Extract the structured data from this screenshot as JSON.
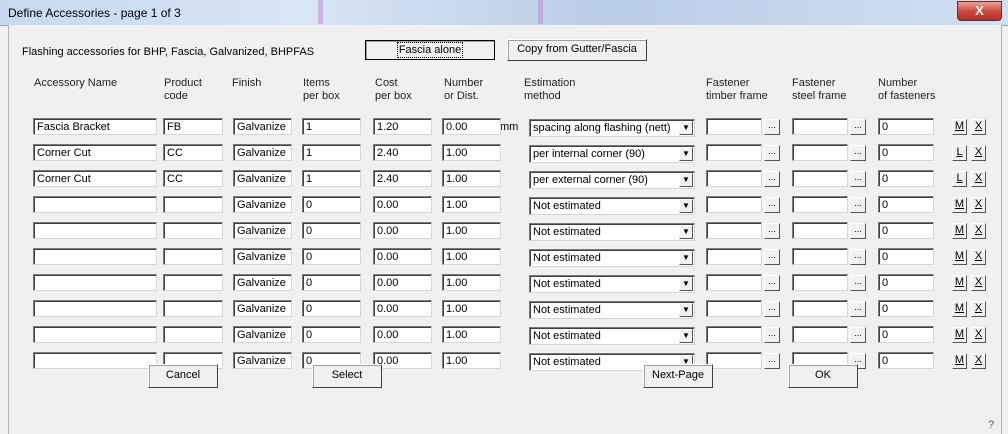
{
  "window": {
    "title": "Define Accessories - page 1 of 3",
    "close_label": "X"
  },
  "top": {
    "subtitle": "Flashing accessories for BHP, Fascia, Galvanized, BHPFAS",
    "fascia_alone": "Fascia alone",
    "copy_from": "Copy from Gutter/Fascia"
  },
  "headers": {
    "name": "Accessory Name",
    "code1": "Product",
    "code2": "code",
    "finish": "Finish",
    "items1": "Items",
    "items2": "per box",
    "cost1": "Cost",
    "cost2": "per box",
    "num1": "Number",
    "num2": "or Dist.",
    "est1": "Estimation",
    "est2": "method",
    "ft1": "Fastener",
    "ft2": "timber frame",
    "fs1": "Fastener",
    "fs2": "steel frame",
    "nf1": "Number",
    "nf2": "of fasteners"
  },
  "unit_mm": "mm",
  "dots_label": "...",
  "rows": [
    {
      "name": "Fascia Bracket",
      "code": "FB",
      "finish": "Galvanize",
      "items": "1",
      "cost": "1.20",
      "num": "0.00",
      "method": "spacing along flashing (nett)",
      "ft": "",
      "fs": "",
      "nfast": "0",
      "btn": "M",
      "del": "X"
    },
    {
      "name": "Corner Cut",
      "code": "CC",
      "finish": "Galvanize",
      "items": "1",
      "cost": "2.40",
      "num": "1.00",
      "method": "per internal corner (90)",
      "ft": "",
      "fs": "",
      "nfast": "0",
      "btn": "L",
      "del": "X"
    },
    {
      "name": "Corner Cut",
      "code": "CC",
      "finish": "Galvanize",
      "items": "1",
      "cost": "2.40",
      "num": "1.00",
      "method": "per external corner (90)",
      "ft": "",
      "fs": "",
      "nfast": "0",
      "btn": "L",
      "del": "X"
    },
    {
      "name": "",
      "code": "",
      "finish": "Galvanize",
      "items": "0",
      "cost": "0.00",
      "num": "1.00",
      "method": "Not estimated",
      "ft": "",
      "fs": "",
      "nfast": "0",
      "btn": "M",
      "del": "X"
    },
    {
      "name": "",
      "code": "",
      "finish": "Galvanize",
      "items": "0",
      "cost": "0.00",
      "num": "1.00",
      "method": "Not estimated",
      "ft": "",
      "fs": "",
      "nfast": "0",
      "btn": "M",
      "del": "X"
    },
    {
      "name": "",
      "code": "",
      "finish": "Galvanize",
      "items": "0",
      "cost": "0.00",
      "num": "1.00",
      "method": "Not estimated",
      "ft": "",
      "fs": "",
      "nfast": "0",
      "btn": "M",
      "del": "X"
    },
    {
      "name": "",
      "code": "",
      "finish": "Galvanize",
      "items": "0",
      "cost": "0.00",
      "num": "1.00",
      "method": "Not estimated",
      "ft": "",
      "fs": "",
      "nfast": "0",
      "btn": "M",
      "del": "X"
    },
    {
      "name": "",
      "code": "",
      "finish": "Galvanize",
      "items": "0",
      "cost": "0.00",
      "num": "1.00",
      "method": "Not estimated",
      "ft": "",
      "fs": "",
      "nfast": "0",
      "btn": "M",
      "del": "X"
    },
    {
      "name": "",
      "code": "",
      "finish": "Galvanize",
      "items": "0",
      "cost": "0.00",
      "num": "1.00",
      "method": "Not estimated",
      "ft": "",
      "fs": "",
      "nfast": "0",
      "btn": "M",
      "del": "X"
    },
    {
      "name": "",
      "code": "",
      "finish": "Galvanize",
      "items": "0",
      "cost": "0.00",
      "num": "1.00",
      "method": "Not estimated",
      "ft": "",
      "fs": "",
      "nfast": "0",
      "btn": "M",
      "del": "X"
    }
  ],
  "buttons": {
    "cancel": "Cancel",
    "select": "Select",
    "next_page": "Next-Page",
    "ok": "OK"
  },
  "help_mark": "?"
}
